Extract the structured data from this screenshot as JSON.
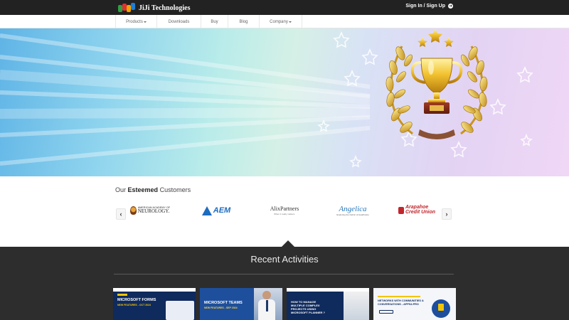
{
  "header": {
    "brand": "JiJi Technologies",
    "signin_label": "Sign In / Sign Up"
  },
  "nav": {
    "items": [
      {
        "label": "Products",
        "dropdown": true
      },
      {
        "label": "Downloads",
        "dropdown": false
      },
      {
        "label": "Buy",
        "dropdown": false
      },
      {
        "label": "Blog",
        "dropdown": false
      },
      {
        "label": "Company",
        "dropdown": true
      }
    ]
  },
  "customers": {
    "title_prefix": "Our",
    "title_bold": "Esteemed",
    "title_suffix": "Customers",
    "prev_icon": "chevron-left-icon",
    "next_icon": "chevron-right-icon",
    "logos": [
      {
        "line1": "AMERICAN ACADEMY OF",
        "line2": "NEUROLOGY."
      },
      {
        "text": "AEM"
      },
      {
        "line1": "AlixPartners",
        "line2": "When it really matters."
      },
      {
        "line1": "Angelica",
        "line2": "Exploring the Fabric of Healthcare"
      },
      {
        "line1": "Arapahoe",
        "line2": "Credit Union"
      }
    ]
  },
  "recent": {
    "title": "Recent Activities",
    "cards": [
      {
        "line1": "MICROSOFT FORMS",
        "line2": "NEW FEATURES - OCT 2024"
      },
      {
        "line1": "MICROSOFT TEAMS",
        "line2": "NEW FEATURES - SEP 2024"
      },
      {
        "line1": "HOW TO MANAGE",
        "line2": "MULTIPLE COMPLEX",
        "line3": "PROJECTS USING",
        "line4": "MICROSOFT PLANNER ?"
      },
      {
        "line1": "NETWORKS WITH COMMUNITIES &",
        "line2": "CONVERSATIONS - APPS4.PRO"
      }
    ]
  },
  "colors": {
    "topbar": "#222222",
    "recent_bg": "#2d2d2d",
    "card_navy": "#0f2a5c",
    "accent_yellow": "#f4c400"
  }
}
